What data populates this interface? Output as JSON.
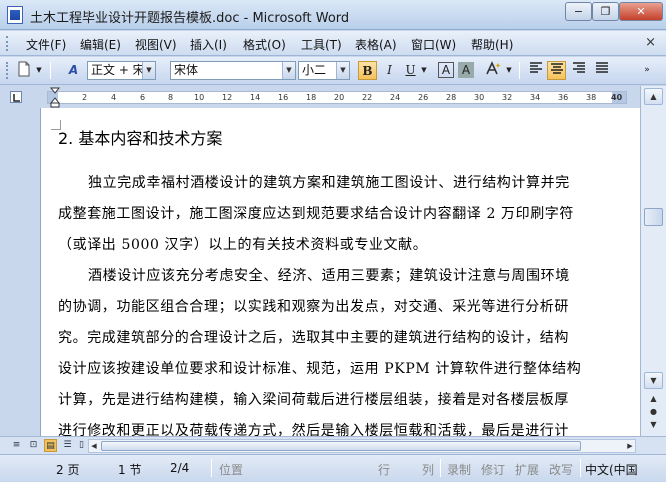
{
  "window": {
    "title": "土木工程毕业设计开题报告模板.doc - Microsoft Word",
    "minimize": "−",
    "restore": "❐",
    "close": "✕"
  },
  "menu": {
    "items": [
      "文件(F)",
      "编辑(E)",
      "视图(V)",
      "插入(I)",
      "格式(O)",
      "工具(T)",
      "表格(A)",
      "窗口(W)",
      "帮助(H)"
    ],
    "close_doc": "×"
  },
  "toolbar": {
    "style_value": "正文 + 宋体",
    "font_value": "宋体",
    "size_value": "小二",
    "bold": "B",
    "italic": "I",
    "underline": "U",
    "font_color": "A",
    "char_border": "A",
    "char_shading": "A",
    "styles_icon": "A"
  },
  "ruler": {
    "ticks": [
      "2",
      "4",
      "6",
      "8",
      "10",
      "12",
      "14",
      "16",
      "18",
      "20",
      "22",
      "24",
      "26",
      "28",
      "30",
      "32",
      "34",
      "36",
      "38",
      "40"
    ]
  },
  "document": {
    "heading": "2. 基本内容和技术方案",
    "lines": [
      "独立完成幸福村酒楼设计的建筑方案和建筑施工图设计、进行结构计算并完",
      "成整套施工图设计，施工图深度应达到规范要求结合设计内容翻译 2 万印刷字符",
      "（或译出 5000 汉字）以上的有关技术资料或专业文献。",
      "酒楼设计应该充分考虑安全、经济、适用三要素；建筑设计注意与周围环境",
      "的协调，功能区组合合理；以实践和观察为出发点，对交通、采光等进行分析研",
      "究。完成建筑部分的合理设计之后，选取其中主要的建筑进行结构的设计，结构",
      "设计应该按建设单位要求和设计标准、规范，运用 PKPM 计算软件进行整体结构",
      "计算，先是进行结构建模，输入梁间荷载后进行楼层组装，接着是对各楼层板厚",
      "进行修改和更正以及荷载传递方式，然后是输入楼层恒载和活载，最后是进行计"
    ]
  },
  "statusbar": {
    "page": "2 页",
    "section": "1 节",
    "page_of": "2/4",
    "position": "位置",
    "line": "行",
    "column": "列",
    "rec": "录制",
    "trk": "修订",
    "ext": "扩展",
    "ovr": "改写",
    "language": "中文(中国"
  },
  "colors": {
    "accent": "#f5c15a",
    "chrome": "#c8d7ec"
  }
}
